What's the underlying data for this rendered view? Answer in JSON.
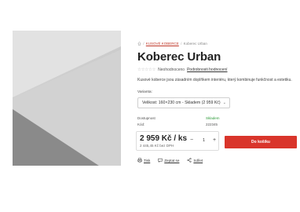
{
  "breadcrumb": {
    "category": "KUSOVÉ KOBERCE",
    "separator": "/",
    "current": "Koberec Urban"
  },
  "product": {
    "title": "Koberec Urban",
    "rating_text": "Neohodnoceno",
    "rating_link": "Podrobnosti hodnocení",
    "description": "Kusové koberce jsou zásadním doplňkem interiéru, který kombinuje funkčnost a estetiku."
  },
  "variant": {
    "label": "Varianta:",
    "selected": "Velikost: 160×230 cm - Skladem (2 959 Kč)"
  },
  "info": {
    "availability_label": "Dostupnost",
    "availability_value": "Skladem",
    "code_label": "Kód:",
    "code_value": "222345"
  },
  "price": {
    "main": "2 959 Kč / ks",
    "without_vat": "2 445,45 Kč bez DPH"
  },
  "quantity": {
    "minus": "−",
    "value": "1",
    "plus": "+"
  },
  "cart_button": "Do košíku",
  "actions": {
    "print": "Tisk",
    "ask": "Zeptat se",
    "share": "Sdílet"
  },
  "colors": {
    "accent": "#d9352b",
    "in_stock": "#2e9b3a"
  }
}
